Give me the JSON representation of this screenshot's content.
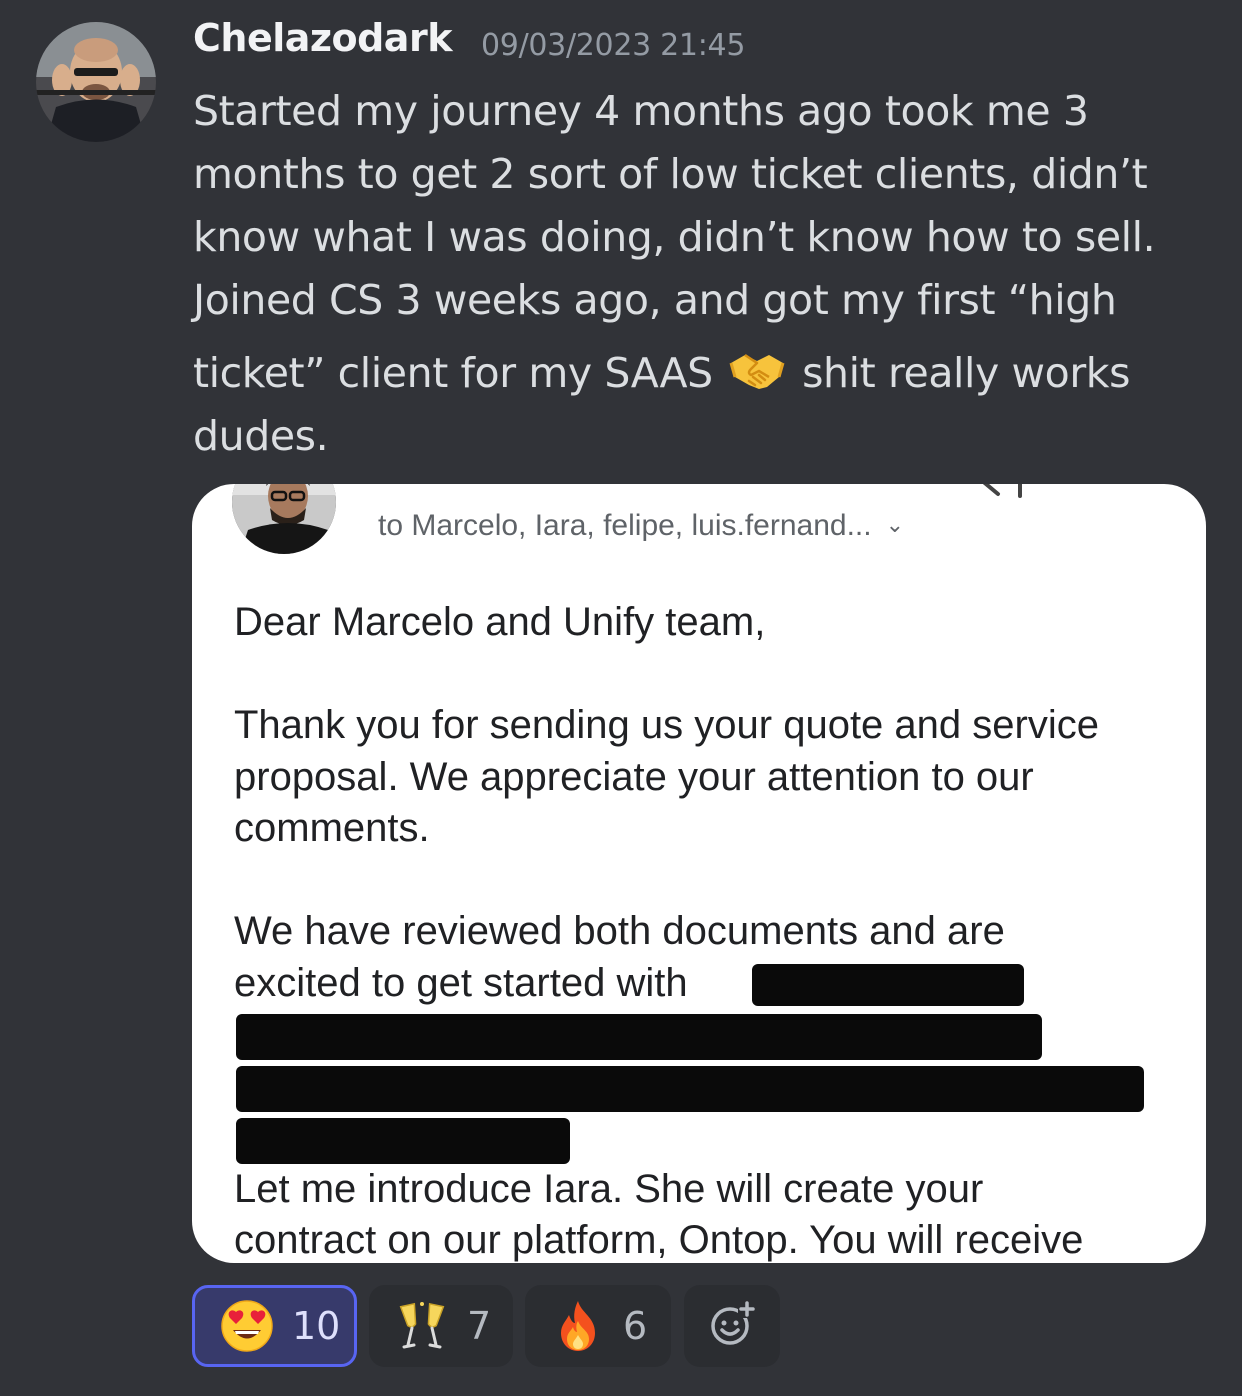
{
  "message": {
    "author": "Chelazodark",
    "timestamp": "09/03/2023 21:45",
    "lines": [
      "Started my journey 4 months ago took me 3",
      "months to get 2 sort of low ticket clients, didn’t",
      "know what I was doing, didn’t know how to sell.",
      "Joined CS 3 weeks ago, and got my first “high"
    ],
    "line5_before_emoji": "ticket” client for my SAAS",
    "line5_after_emoji": "shit really works",
    "line6": "dudes.",
    "inline_emoji": "handshake-emoji"
  },
  "attachment": {
    "recipients": "to Marcelo, Iara, felipe, luis.fernand...",
    "greeting": "Dear Marcelo and Unify team,",
    "para1": [
      "Thank you for sending us your quote and service",
      "proposal. We appreciate your attention to our",
      "comments."
    ],
    "para2_line1": "We have reviewed both documents and are",
    "para2_line2": "excited to get started with",
    "para3": [
      "Let me introduce Iara. She will create your",
      "contract on our platform, Ontop. You will receive"
    ]
  },
  "reactions": [
    {
      "emoji": "heart-eyes-emoji",
      "count": "10",
      "selected": true
    },
    {
      "emoji": "clinking-glasses-emoji",
      "count": "7",
      "selected": false
    },
    {
      "emoji": "fire-emoji",
      "count": "6",
      "selected": false
    }
  ],
  "add_reaction_icon": "add-reaction-icon",
  "colors": {
    "background": "#313338",
    "selected_reaction_border": "#5865f2",
    "selected_reaction_bg": "#373a6b",
    "reaction_bg": "#2b2d31"
  }
}
